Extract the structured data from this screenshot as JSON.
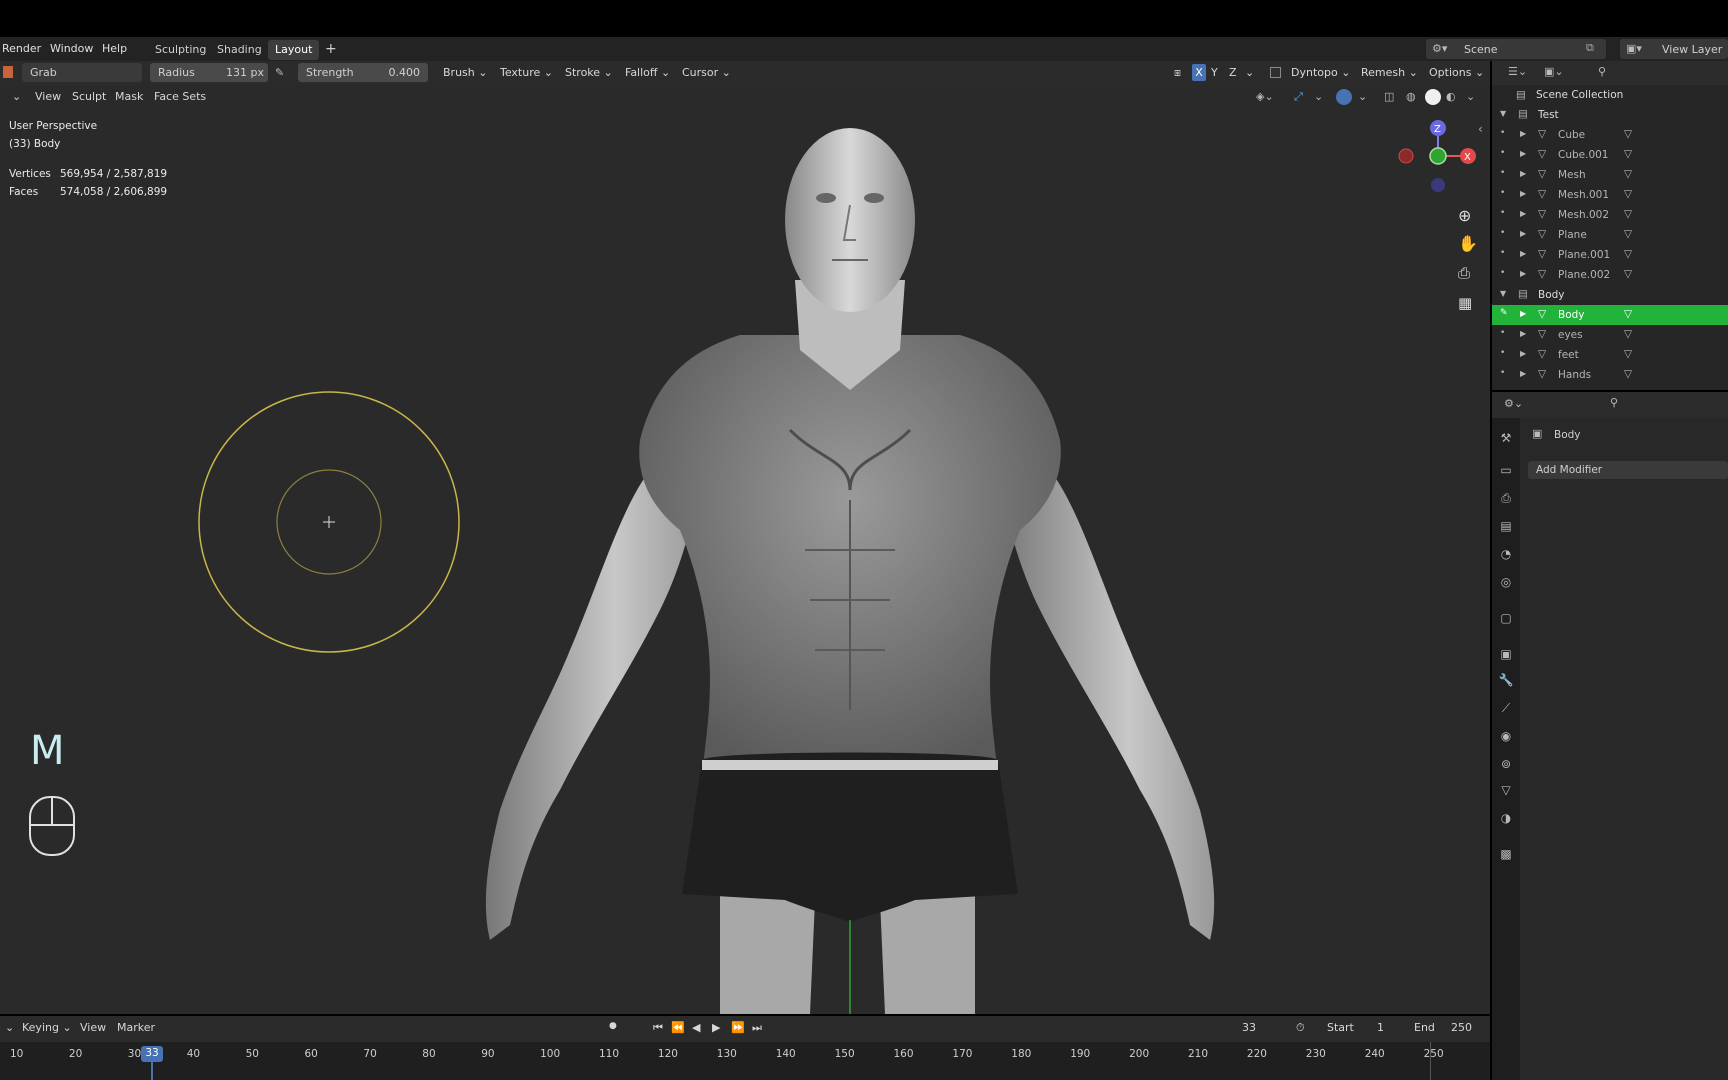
{
  "menubar": {
    "items": [
      "Render",
      "Window",
      "Help"
    ],
    "tabs": [
      "Sculpting",
      "Shading",
      "Layout"
    ],
    "active_tab": "Layout",
    "add_tab": "+",
    "scene": "Scene",
    "view_layer": "View Layer"
  },
  "toolbar": {
    "tool": "Grab",
    "radius_label": "Radius",
    "radius_value": "131 px",
    "strength_label": "Strength",
    "strength_value": "0.400",
    "menus": [
      "Brush",
      "Texture",
      "Stroke",
      "Falloff",
      "Cursor"
    ],
    "axes": [
      "X",
      "Y",
      "Z"
    ],
    "dyntopo": "Dyntopo",
    "remesh": "Remesh",
    "options": "Options"
  },
  "header": {
    "items": [
      "View",
      "Sculpt",
      "Mask",
      "Face Sets"
    ]
  },
  "viewport": {
    "perspective": "User Perspective",
    "object": "(33) Body",
    "vertices_label": "Vertices",
    "vertices_value": "569,954 / 2,587,819",
    "faces_label": "Faces",
    "faces_value": "574,058 / 2,606,899",
    "key_hint": "M",
    "gizmo": {
      "z": "Z",
      "x": "X"
    }
  },
  "outliner": {
    "scene_collection": "Scene Collection",
    "rows": [
      {
        "name": "Test",
        "type": "collection"
      },
      {
        "name": "Cube",
        "type": "mesh"
      },
      {
        "name": "Cube.001",
        "type": "mesh"
      },
      {
        "name": "Mesh",
        "type": "mesh"
      },
      {
        "name": "Mesh.001",
        "type": "mesh"
      },
      {
        "name": "Mesh.002",
        "type": "mesh"
      },
      {
        "name": "Plane",
        "type": "mesh"
      },
      {
        "name": "Plane.001",
        "type": "mesh"
      },
      {
        "name": "Plane.002",
        "type": "mesh"
      },
      {
        "name": "Body",
        "type": "collection"
      },
      {
        "name": "Body",
        "type": "mesh",
        "selected": true
      },
      {
        "name": "eyes",
        "type": "mesh"
      },
      {
        "name": "feet",
        "type": "mesh"
      },
      {
        "name": "Hands",
        "type": "mesh"
      }
    ],
    "selected_color": "#22b43a"
  },
  "properties": {
    "object_name": "Body",
    "add_modifier": "Add Modifier"
  },
  "timeline": {
    "menus": [
      "Keying",
      "View",
      "Marker"
    ],
    "current_frame": "33",
    "start_label": "Start",
    "start_value": "1",
    "end_label": "End",
    "end_value": "250",
    "ticks": [
      "10",
      "20",
      "30",
      "40",
      "50",
      "60",
      "70",
      "80",
      "90",
      "100",
      "110",
      "120",
      "130",
      "140",
      "150",
      "160",
      "170",
      "180",
      "190",
      "200",
      "210",
      "220",
      "230",
      "240",
      "250"
    ]
  }
}
